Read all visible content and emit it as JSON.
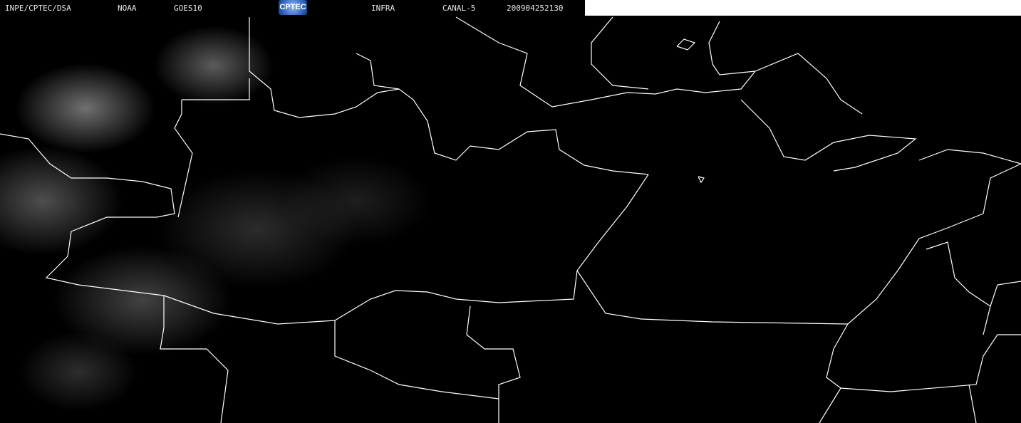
{
  "header": {
    "source": "INPE/CPTEC/DSA",
    "agency": "NOAA",
    "satellite": "GOES10",
    "logo_text": "CPTEC",
    "band": "INFRA",
    "channel": "CANAL-5",
    "timestamp": "200904252130"
  },
  "colors": {
    "background": "#000000",
    "borders": "#ffffff",
    "header_text": "#e8e8e8"
  }
}
